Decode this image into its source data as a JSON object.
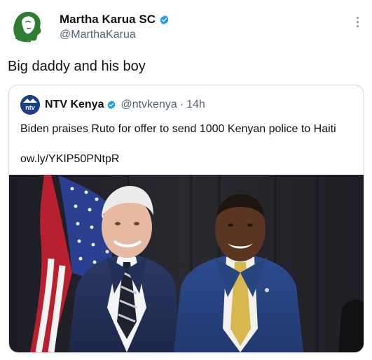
{
  "author": {
    "display_name": "Martha Karua SC",
    "handle": "@MarthaKarua",
    "avatar_icon": "portrait-logo-icon",
    "verified_icon": "verified-badge-icon"
  },
  "tweet": {
    "text": "Big daddy and his boy"
  },
  "quoted": {
    "display_name": "NTV Kenya",
    "handle": "@ntvkenya",
    "separator": "·",
    "time": "14h",
    "avatar_text": "ntv",
    "text": "Biden praises Ruto for offer to send 1000 Kenyan police to Haiti",
    "link": "ow.ly/YKIP50PNtpR",
    "image_icon": "photo-two-men-flag-icon"
  },
  "colors": {
    "accent": "#1d9bf0",
    "secondary_text": "#536471",
    "border": "#cfd9de",
    "logo_green": "#2e7d32"
  }
}
